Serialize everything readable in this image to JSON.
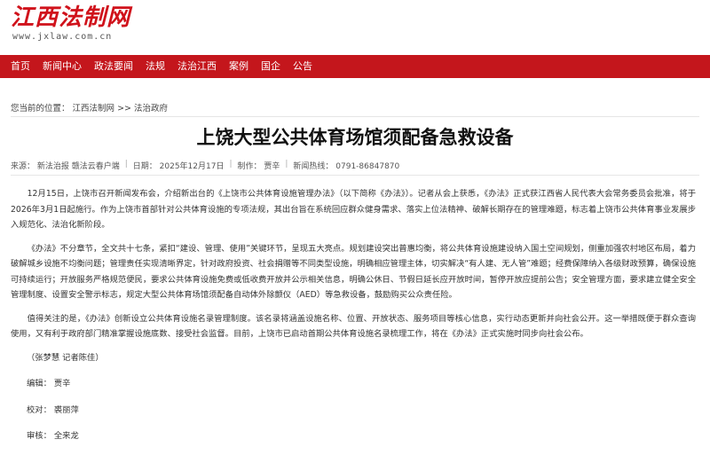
{
  "header": {
    "logo_text": "江西法制网",
    "logo_url": "www.jxlaw.com.cn"
  },
  "nav": {
    "items": [
      "首页",
      "新闻中心",
      "政法要闻",
      "法规",
      "法治江西",
      "案例",
      "国企",
      "公告"
    ]
  },
  "breadcrumb": {
    "prefix": "您当前的位置：",
    "site": "江西法制网",
    "separator": ">>",
    "section": "法治政府"
  },
  "article": {
    "title": "上饶大型公共体育场馆须配备急救设备",
    "meta": {
      "source": "来源：  新法治报 赣法云春户端",
      "date": "日期：  2025年12月17日",
      "author": "制作：  贾辛",
      "hotline": "新闻热线：  0791-86847870"
    },
    "paragraphs": [
      "12月15日，上饶市召开新闻发布会，介绍新出台的《上饶市公共体育设施管理办法》（以下简称《办法》）。记者从会上获悉，《办法》正式获江西省人民代表大会常务委员会批准，将于2026年3月1日起施行。作为上饶市首部针对公共体育设施的专项法规，其出台旨在系统回应群众健身需求、落实上位法精神、破解长期存在的管理难题，标志着上饶市公共体育事业发展步入规范化、法治化新阶段。",
      "《办法》不分章节，全文共十七条，紧扣“建设、管理、使用”关键环节，呈现五大亮点。规划建设突出普惠均衡，将公共体育设施建设纳入国土空间规划，侧重加强农村地区布局，着力破解城乡设施不均衡问题；管理责任实现清晰界定，针对政府投资、社会捐赠等不同类型设施，明确相应管理主体，切实解决“有人建、无人管”难题；经费保障纳入各级财政预算，确保设施可持续运行；开放服务严格规范便民，要求公共体育设施免费或低收费开放并公示相关信息，明确公休日、节假日延长应开放时间，暂停开放应提前公告；安全管理方面，要求建立健全安全管理制度、设置安全警示标志，规定大型公共体育场馆须配备自动体外除颤仪（AED）等急救设备，鼓励购买公众责任险。",
      "值得关注的是，《办法》创新设立公共体育设施名录管理制度。该名录将涵盖设施名称、位置、开放状态、服务项目等核心信息，实行动态更新并向社会公开。这一举措既便于群众查询使用，又有利于政府部门精准掌握设施底数、接受社会监督。目前，上饶市已启动首期公共体育设施名录梳理工作，将在《办法》正式实施时同步向社会公布。"
    ],
    "credit": "（张梦慧 记者陈佳）",
    "editor": "编辑：  贾辛",
    "proofreader": "校对：  裘丽萍",
    "reviewer": "审核：  全来龙"
  }
}
